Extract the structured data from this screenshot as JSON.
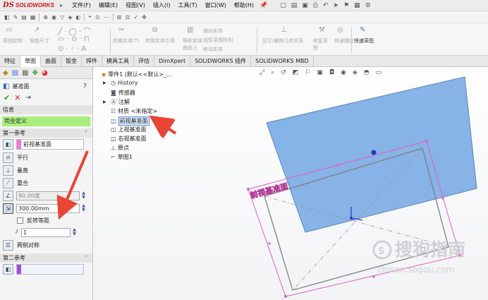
{
  "app": {
    "logo_ds": "DS",
    "logo_name": "SOLIDWORKS",
    "menu": [
      "文件(F)",
      "编辑(E)",
      "视图(V)",
      "插入(I)",
      "工具(T)",
      "窗口(W)",
      "帮助(H)"
    ]
  },
  "ribbon": {
    "sketch_fillet": "草图绘制",
    "smart_dim": "智能尺寸",
    "trim": "剪裁实体(T)",
    "convert": "转换实体引用",
    "offset": "等距实体",
    "surface_offset": "曲面上",
    "mirror": "镜向实体",
    "linear_pattern": "线性草图阵列",
    "move": "移动实体",
    "relations": "显示/删除几何关系",
    "repair": "修复草图",
    "quick_snap": "快速捕捉",
    "rapid_sketch": "快速草图"
  },
  "tabs": [
    "特征",
    "草图",
    "曲面",
    "钣金",
    "焊件",
    "模具工具",
    "评估",
    "DimXpert",
    "SOLIDWORKS 插件",
    "SOLIDWORKS MBD"
  ],
  "active_tab": "草图",
  "property_manager": {
    "title": "基准面",
    "help": "?",
    "info_header": "信息",
    "info_status": "完全定义",
    "first_ref_header": "第一参考",
    "first_ref_value": "前视基准面",
    "options": [
      "平行",
      "垂直",
      "重合"
    ],
    "angle_value": "90.00度",
    "distance_value": "300.00mm",
    "flip_label": "反转等距",
    "count_value": "1",
    "mid_plane_label": "两侧对称",
    "second_ref_header": "第二参考"
  },
  "tree": {
    "part": "零件1 (默认<<默认>_...",
    "history": "History",
    "sensors": "传感器",
    "annotations": "注解",
    "material": "材质 <未指定>",
    "front_plane": "前视基准面",
    "top_plane": "上视基准面",
    "right_plane": "右视基准面",
    "origin": "原点",
    "sketch": "草图1"
  },
  "viewport": {
    "plane_label": "前视基准面",
    "watermark_main": "搜狗指南",
    "watermark_url": "zhinan.sogou.com"
  },
  "colors": {
    "plane_fill": "#7eaee6",
    "pink": "#e060c0",
    "status_green": "#a8ee7c",
    "arrow_red": "#e84535"
  }
}
